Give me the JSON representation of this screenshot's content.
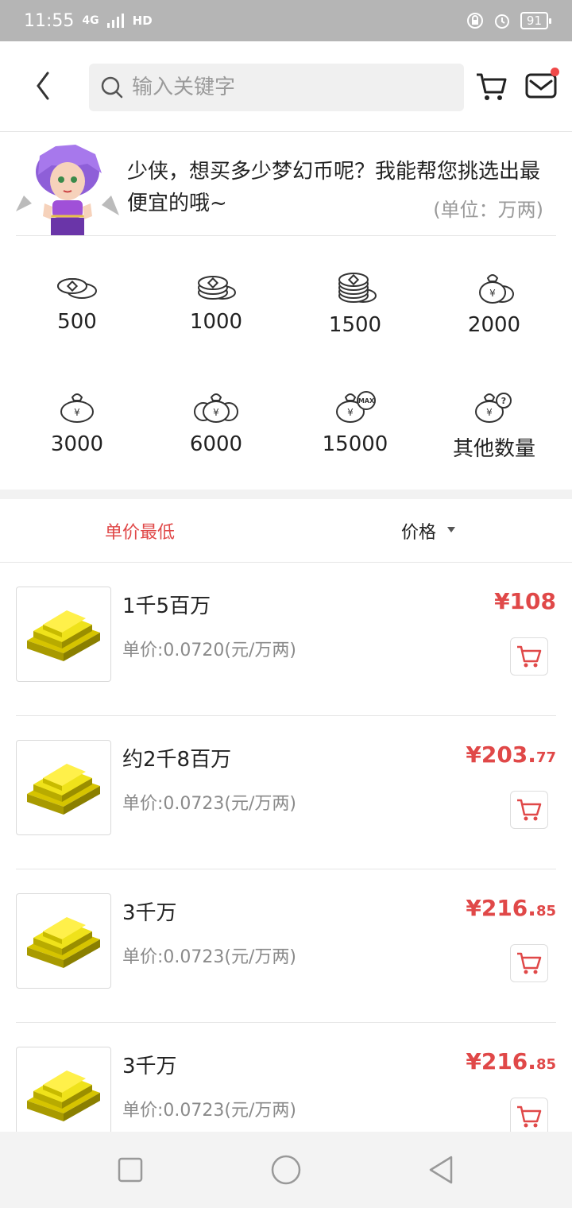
{
  "status_bar": {
    "time": "11:55",
    "network": "4G",
    "signal": "HD",
    "battery": "91"
  },
  "header": {
    "search_placeholder": "输入关键字"
  },
  "banner": {
    "text": "少侠，想买多少梦幻币呢？我能帮您挑选出最便宜的哦~",
    "unit": "(单位：万两)"
  },
  "amounts": [
    "500",
    "1000",
    "1500",
    "2000",
    "3000",
    "6000",
    "15000",
    "其他数量"
  ],
  "sort": {
    "left": "单价最低",
    "right": "价格"
  },
  "products": [
    {
      "title": "1千5百万",
      "unit_price": "单价:0.0720(元/万两)",
      "price_int": "¥108",
      "price_dec": ""
    },
    {
      "title": "约2千8百万",
      "unit_price": "单价:0.0723(元/万两)",
      "price_int": "¥203.",
      "price_dec": "77"
    },
    {
      "title": "3千万",
      "unit_price": "单价:0.0723(元/万两)",
      "price_int": "¥216.",
      "price_dec": "85"
    },
    {
      "title": "3千万",
      "unit_price": "单价:0.0723(元/万两)",
      "price_int": "¥216.",
      "price_dec": "85"
    }
  ],
  "colors": {
    "accent": "#e04848",
    "statusbar": "#b5b5b5"
  }
}
